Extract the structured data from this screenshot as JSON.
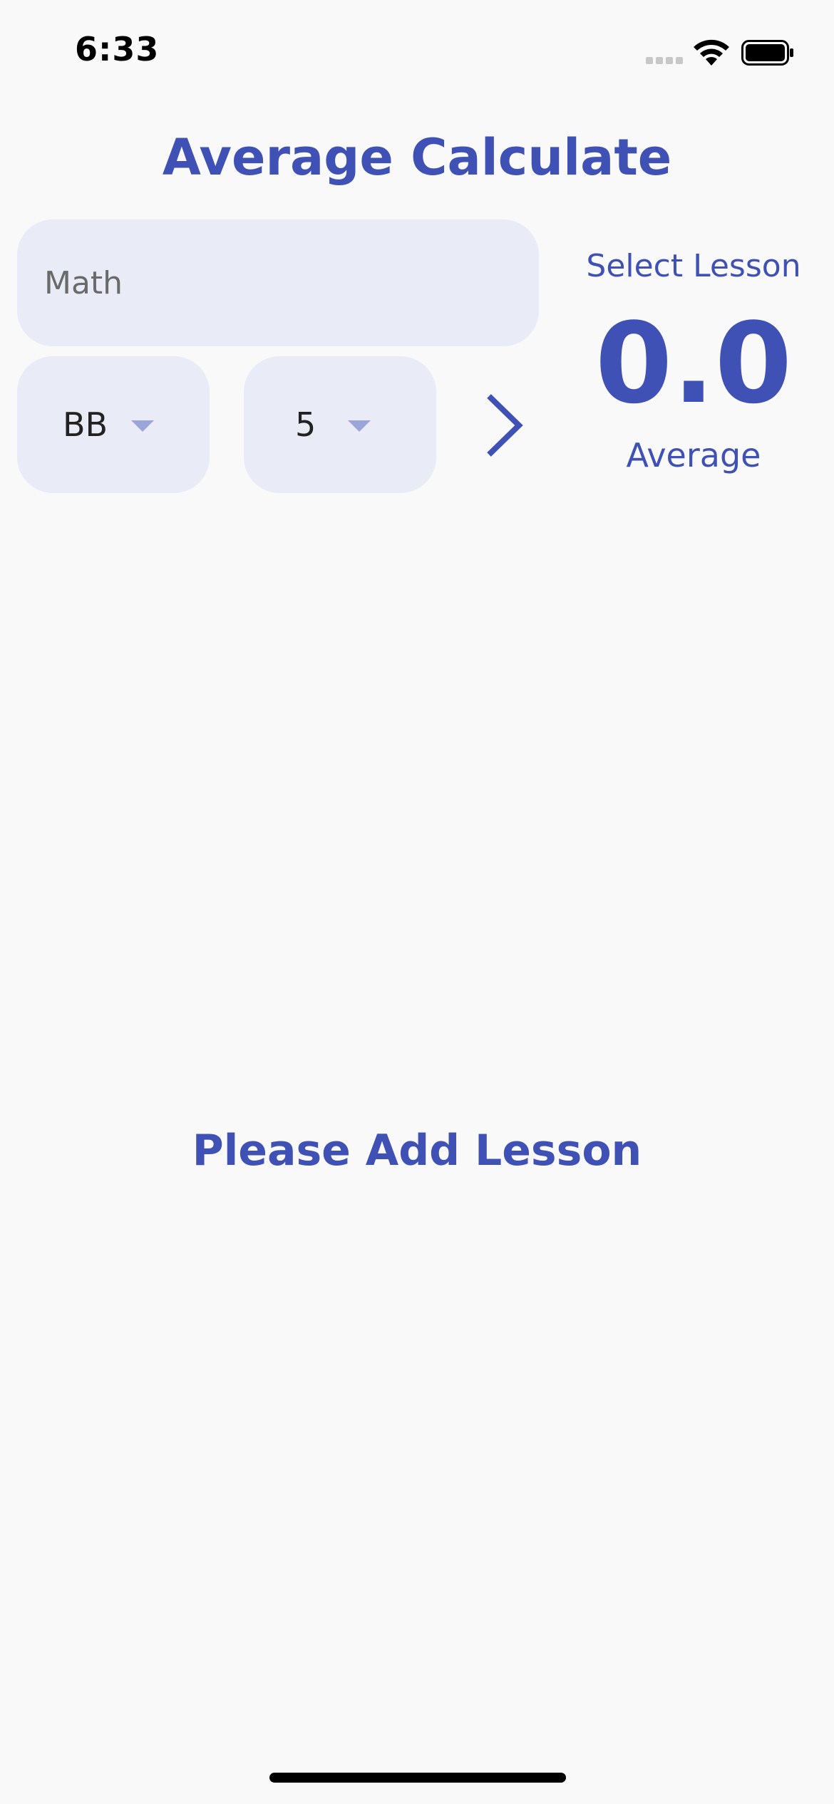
{
  "status_bar": {
    "time": "6:33",
    "icons": [
      "signal-icon",
      "wifi-icon",
      "battery-icon"
    ]
  },
  "header": {
    "title": "Average Calculate"
  },
  "form": {
    "lesson_placeholder": "Math",
    "lesson_value": "",
    "grade_selected": "BB",
    "credit_selected": "5",
    "add_icon": "chevron-right-icon"
  },
  "average_panel": {
    "caption": "Select Lesson",
    "value": "0.0",
    "label": "Average"
  },
  "lesson_list": {
    "empty_message": "Please Add Lesson"
  },
  "colors": {
    "accent": "#3f51b5",
    "field_background": "#e9ecf6",
    "page_background": "#f9f9f9",
    "dropdown_arrow": "#9ca5d8"
  }
}
